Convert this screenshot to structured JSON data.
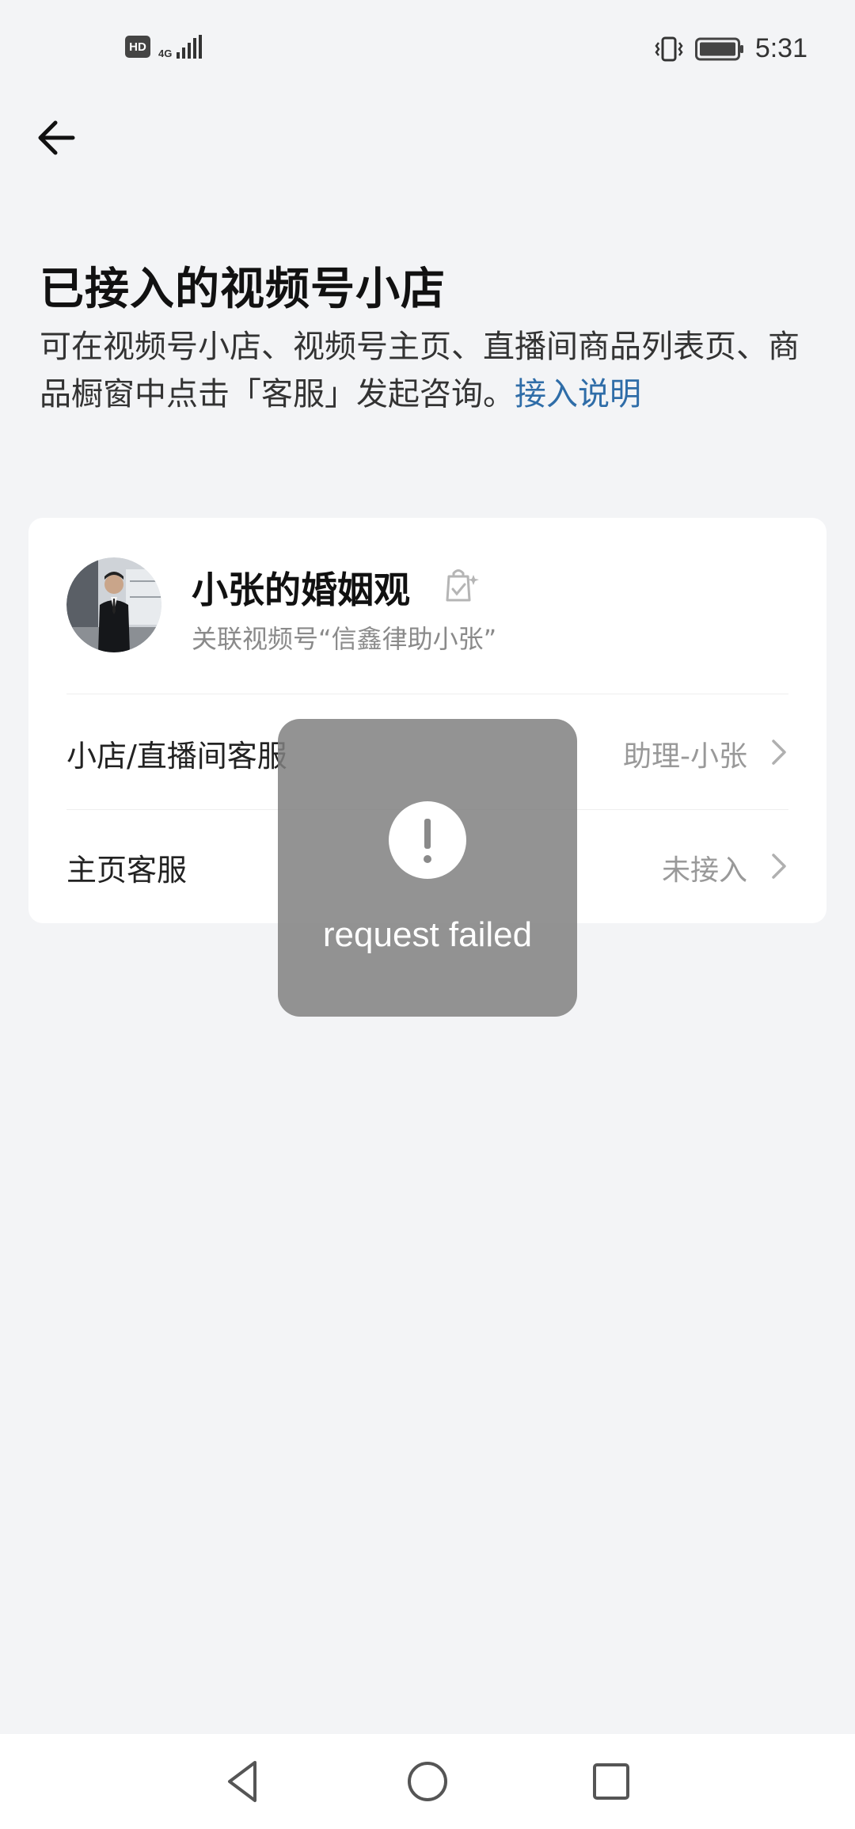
{
  "status_bar": {
    "hd_label": "HD",
    "network_label": "4G",
    "time": "5:31"
  },
  "header": {
    "title": "已接入的视频号小店",
    "description": "可在视频号小店、视频号主页、直播间商品列表页、商品橱窗中点击「客服」发起咨询。",
    "link_text": "接入说明"
  },
  "shop": {
    "name": "小张的婚姻观",
    "subtitle": "关联视频号“信鑫律助小张”",
    "badge_icon": "shop-bag-check-icon"
  },
  "rows": [
    {
      "label": "小店/直播间客服",
      "value": "助理-小张"
    },
    {
      "label": "主页客服",
      "value": "未接入"
    }
  ],
  "toast": {
    "icon": "exclamation-icon",
    "message": "request failed"
  },
  "colors": {
    "background": "#f3f4f6",
    "link": "#2f6da8",
    "toast_bg": "#8a8a8a"
  }
}
